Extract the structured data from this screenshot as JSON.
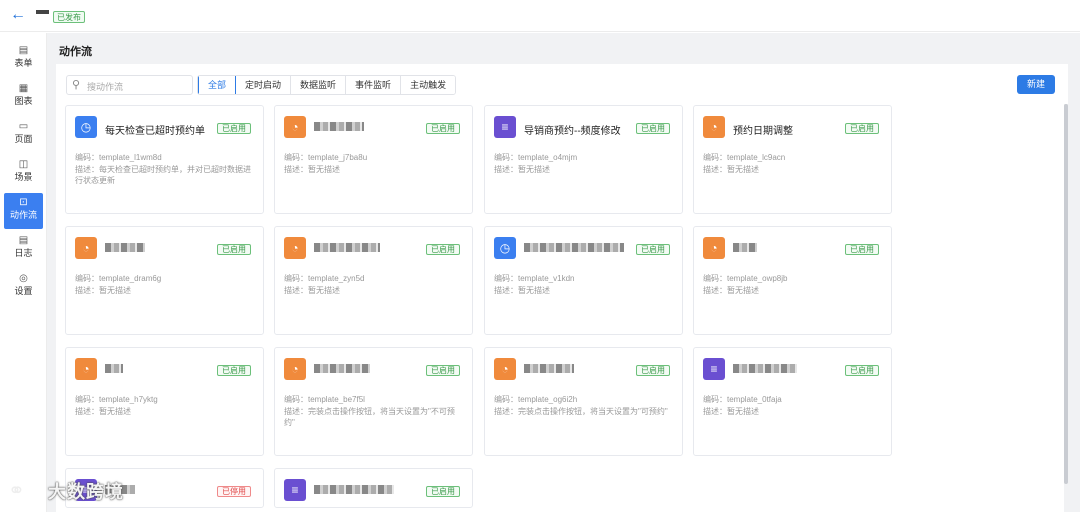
{
  "header": {
    "back_icon": "back-arrow-icon",
    "status_badge": "已发布"
  },
  "sidebar": {
    "items": [
      {
        "label": "表单",
        "icon": "form-icon",
        "glyph": "▤",
        "active": false
      },
      {
        "label": "图表",
        "icon": "chart-icon",
        "glyph": "▦",
        "active": false
      },
      {
        "label": "页面",
        "icon": "page-icon",
        "glyph": "▭",
        "active": false
      },
      {
        "label": "场景",
        "icon": "scene-icon",
        "glyph": "◫",
        "active": false
      },
      {
        "label": "动作流",
        "icon": "workflow-icon",
        "glyph": "⊡",
        "active": true
      },
      {
        "label": "日志",
        "icon": "log-icon",
        "glyph": "▤",
        "active": false
      },
      {
        "label": "设置",
        "icon": "settings-icon",
        "glyph": "◎",
        "active": false
      }
    ]
  },
  "main": {
    "title": "动作流",
    "search": {
      "placeholder": "搜动作流"
    },
    "tabs": [
      "全部",
      "定时启动",
      "数据监听",
      "事件监听",
      "主动触发"
    ],
    "active_tab": "全部",
    "new_button": "新建"
  },
  "cards": [
    {
      "title": "每天检查已超时预约单",
      "icon_color": "blue",
      "glyph": "◷",
      "status": "已启用",
      "code": "编码：template_l1wm8d",
      "desc": "描述：每天检查已超时预约单，并对已超时数据进行状态更新"
    },
    {
      "title": "",
      "icon_color": "orange",
      "glyph": "◔",
      "status": "已启用",
      "code": "编码：template_j7ba8u",
      "desc": "描述：暂无描述"
    },
    {
      "title": "导销商预约--频度修改",
      "icon_color": "purple",
      "glyph": "≡",
      "status": "已启用",
      "code": "编码：template_o4mjm",
      "desc": "描述：暂无描述"
    },
    {
      "title": "预约日期调整",
      "icon_color": "orange",
      "glyph": "◔",
      "status": "已启用",
      "code": "编码：template_lc9acn",
      "desc": "描述：暂无描述"
    },
    {
      "title": "",
      "icon_color": "orange",
      "glyph": "◔",
      "status": "已启用",
      "code": "编码：template_dram6g",
      "desc": "描述：暂无描述"
    },
    {
      "title": "",
      "icon_color": "orange",
      "glyph": "◔",
      "status": "已启用",
      "code": "编码：template_zyn5d",
      "desc": "描述：暂无描述"
    },
    {
      "title": "",
      "icon_color": "blue",
      "glyph": "◷",
      "status": "已启用",
      "code": "编码：template_v1kdn",
      "desc": "描述：暂无描述"
    },
    {
      "title": "",
      "icon_color": "orange",
      "glyph": "◔",
      "status": "已启用",
      "code": "编码：template_owp8jb",
      "desc": "描述：暂无描述"
    },
    {
      "title": "",
      "icon_color": "orange",
      "glyph": "◔",
      "status": "已启用",
      "code": "编码：template_h7yktg",
      "desc": "描述：暂无描述"
    },
    {
      "title": "",
      "icon_color": "orange",
      "glyph": "◔",
      "status": "已启用",
      "code": "编码：template_be7f5l",
      "desc": "描述：完装点击操作按钮，将当天设置为\"不可预约\""
    },
    {
      "title": "",
      "icon_color": "orange",
      "glyph": "◔",
      "status": "已启用",
      "code": "编码：template_og6i2h",
      "desc": "描述：完装点击操作按钮，将当天设置为\"可预约\""
    },
    {
      "title": "",
      "icon_color": "purple",
      "glyph": "≡",
      "status": "已启用",
      "code": "编码：template_0tfaja",
      "desc": "描述：暂无描述"
    },
    {
      "title": "",
      "icon_color": "purple",
      "glyph": "≡",
      "status": "已停用",
      "code": "",
      "desc": ""
    },
    {
      "title": "",
      "icon_color": "purple",
      "glyph": "≡",
      "status": "已启用",
      "code": "",
      "desc": ""
    }
  ],
  "watermark": {
    "text": "大数跨境"
  }
}
